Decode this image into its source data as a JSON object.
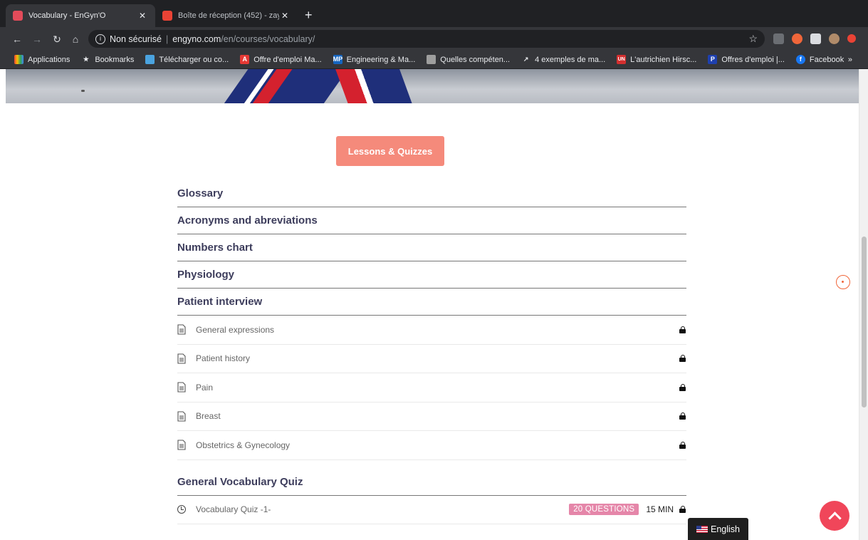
{
  "browser": {
    "tabs": [
      {
        "title": "Vocabulary - EnGyn'O",
        "active": true
      },
      {
        "title": "Boîte de réception (452) - zay",
        "active": false
      }
    ],
    "address": {
      "security": "Non sécurisé",
      "host": "engyno.com",
      "path": "/en/courses/vocabulary/"
    },
    "bookmarks": [
      {
        "label": "Applications",
        "icon": "apps-grid-icon"
      },
      {
        "label": "Bookmarks",
        "icon": "star-icon"
      },
      {
        "label": "Télécharger ou co...",
        "icon": "download-site-icon"
      },
      {
        "label": "Offre d'emploi Ma...",
        "icon": "job-site-icon"
      },
      {
        "label": "Engineering & Ma...",
        "icon": "mp-site-icon",
        "badge": "MP"
      },
      {
        "label": "Quelles compéten...",
        "icon": "drive-icon"
      },
      {
        "label": "4 exemples de ma...",
        "icon": "link-icon"
      },
      {
        "label": "L'autrichien Hirsc...",
        "icon": "un-site-icon",
        "badge": "UN"
      },
      {
        "label": "Offres d'emploi |...",
        "icon": "p-site-icon",
        "badge": "P"
      },
      {
        "label": "Facebook",
        "icon": "facebook-icon"
      }
    ],
    "bookmarks_more": "»"
  },
  "page": {
    "lessons_button": "Lessons & Quizzes",
    "sections": [
      {
        "title": "Glossary",
        "items": []
      },
      {
        "title": "Acronyms and abreviations",
        "items": []
      },
      {
        "title": "Numbers chart",
        "items": []
      },
      {
        "title": "Physiology",
        "items": []
      },
      {
        "title": "Patient interview",
        "items": [
          "General expressions",
          "Patient history",
          "Pain",
          "Breast",
          "Obstetrics & Gynecology"
        ]
      }
    ],
    "quiz_section": {
      "title": "General Vocabulary Quiz",
      "quiz": {
        "title": "Vocabulary Quiz -1-",
        "questions": "20 QUESTIONS",
        "duration": "15 MIN"
      }
    },
    "language": "English"
  },
  "colors": {
    "accent_button": "#f58a7b",
    "badge": "#e586a9",
    "scroll_top": "#f0465a"
  }
}
